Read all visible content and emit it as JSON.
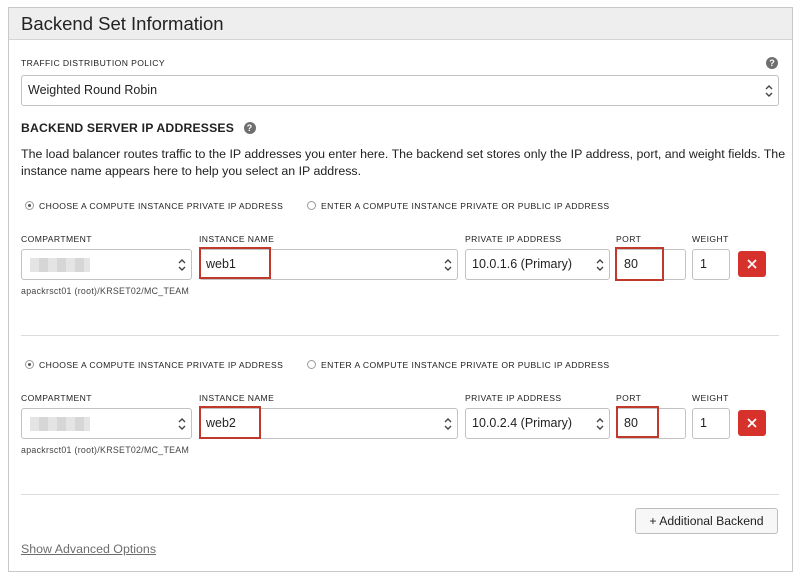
{
  "panel": {
    "title": "Backend Set Information"
  },
  "policy": {
    "label": "TRAFFIC DISTRIBUTION POLICY",
    "value": "Weighted Round Robin"
  },
  "backend_servers": {
    "title": "BACKEND SERVER IP ADDRESSES",
    "description": "The load balancer routes traffic to the IP addresses you enter here. The backend set stores only the IP address, port, and weight fields. The instance name appears here to help you select an IP address."
  },
  "labels": {
    "radio_private": "CHOOSE A COMPUTE INSTANCE PRIVATE IP ADDRESS",
    "radio_public": "ENTER A COMPUTE INSTANCE PRIVATE OR PUBLIC IP ADDRESS",
    "compartment": "COMPARTMENT",
    "instance_name": "INSTANCE NAME",
    "private_ip": "PRIVATE IP ADDRESS",
    "port": "PORT",
    "weight": "WEIGHT"
  },
  "backends": [
    {
      "selected_option": "private",
      "compartment_path": "apackrsct01 (root)/KRSET02/MC_TEAM",
      "instance_name": "web1",
      "private_ip": "10.0.1.6 (Primary)",
      "port": "80",
      "weight": "1"
    },
    {
      "selected_option": "private",
      "compartment_path": "apackrsct01 (root)/KRSET02/MC_TEAM",
      "instance_name": "web2",
      "private_ip": "10.0.2.4 (Primary)",
      "port": "80",
      "weight": "1"
    }
  ],
  "actions": {
    "add_backend": "+ Additional Backend",
    "advanced": "Show Advanced Options"
  },
  "colors": {
    "highlight": "#c0392b",
    "delete_button": "#d6312b",
    "header_bg": "#eeeeee"
  },
  "icons": {
    "help": "help-icon",
    "select_arrows": "updown-chevron-icon",
    "delete": "close-icon"
  }
}
